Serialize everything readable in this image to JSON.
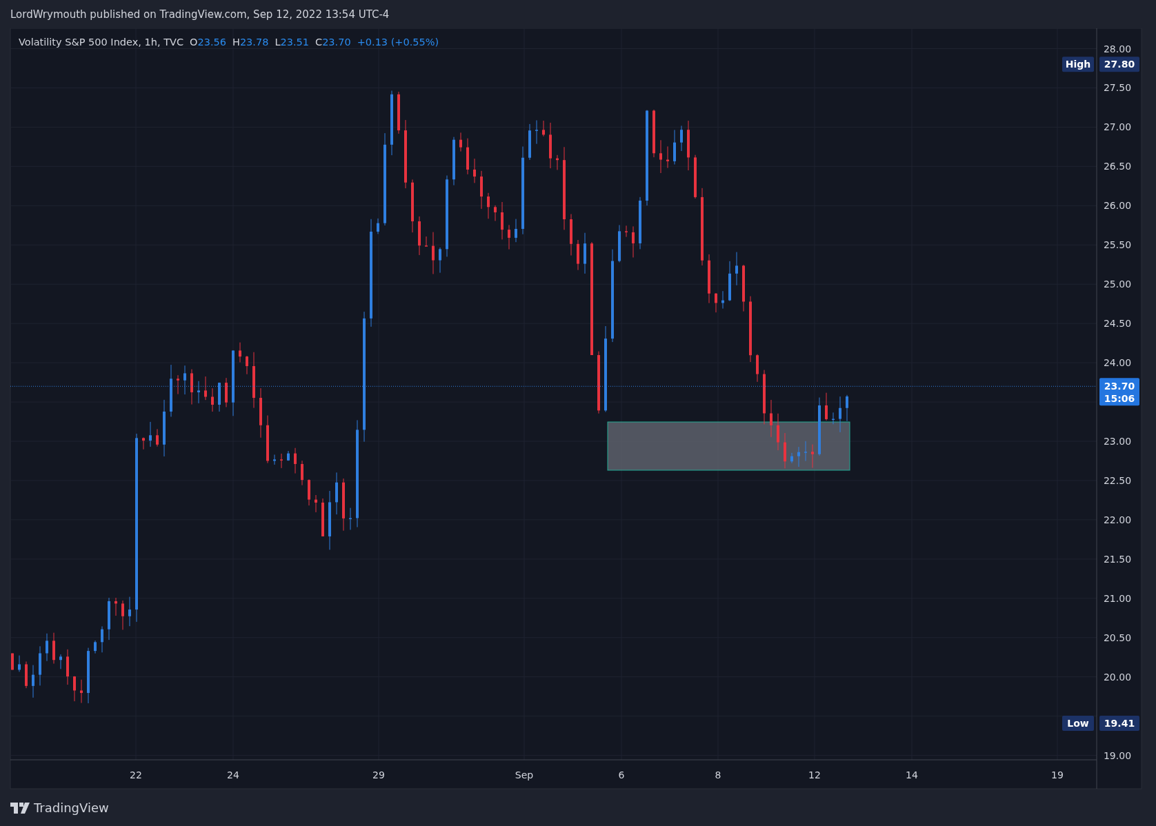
{
  "header": {
    "text": "LordWrymouth published on TradingView.com, Sep 12, 2022 13:54 UTC-4"
  },
  "legend": {
    "symbol": "Volatility S&P 500 Index, 1h, TVC",
    "values": [
      {
        "key": "O",
        "value": "23.56"
      },
      {
        "key": "H",
        "value": "23.78"
      },
      {
        "key": "L",
        "value": "23.51"
      },
      {
        "key": "C",
        "value": "23.70"
      }
    ],
    "change": "+0.13 (+0.55%)"
  },
  "price_axis": {
    "labels": [
      "28.00",
      "27.50",
      "27.00",
      "26.50",
      "26.00",
      "25.50",
      "25.00",
      "24.50",
      "24.00",
      "23.00",
      "22.50",
      "22.00",
      "21.50",
      "21.00",
      "20.50",
      "20.00",
      "19.00"
    ],
    "high": {
      "label": "High",
      "value": "27.80"
    },
    "last": {
      "price": "23.70",
      "countdown": "15:06"
    },
    "low": {
      "label": "Low",
      "value": "19.41"
    }
  },
  "time_axis": {
    "labels": [
      "22",
      "24",
      "29",
      "Sep",
      "6",
      "8",
      "12",
      "14",
      "19"
    ]
  },
  "footer": {
    "logo_text": "TradingView"
  }
}
